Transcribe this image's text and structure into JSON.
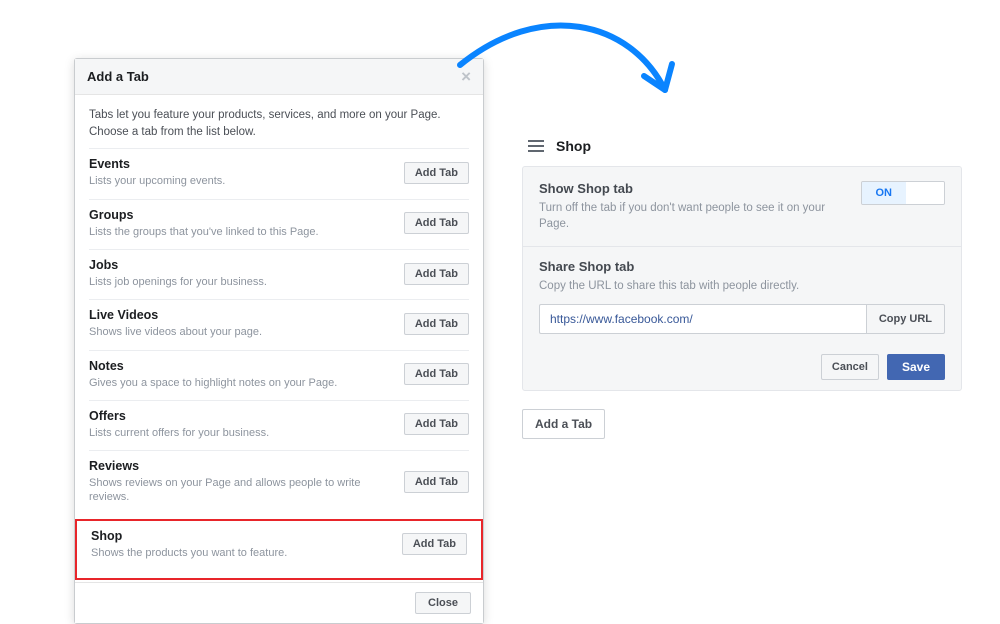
{
  "dialog": {
    "title": "Add a Tab",
    "intro": "Tabs let you feature your products, services, and more on your Page. Choose a tab from the list below.",
    "add_tab_label": "Add Tab",
    "close_label": "Close",
    "tabs": [
      {
        "name": "Events",
        "desc": "Lists your upcoming events."
      },
      {
        "name": "Groups",
        "desc": "Lists the groups that you've linked to this Page."
      },
      {
        "name": "Jobs",
        "desc": "Lists job openings for your business."
      },
      {
        "name": "Live Videos",
        "desc": "Shows live videos about your page."
      },
      {
        "name": "Notes",
        "desc": "Gives you a space to highlight notes on your Page."
      },
      {
        "name": "Offers",
        "desc": "Lists current offers for your business."
      },
      {
        "name": "Reviews",
        "desc": "Shows reviews on your Page and allows people to write reviews."
      },
      {
        "name": "Shop",
        "desc": "Shows the products you want to feature."
      }
    ]
  },
  "panel": {
    "title": "Shop",
    "show": {
      "title": "Show Shop tab",
      "desc": "Turn off the tab if you don't want people to see it on your Page.",
      "state": "ON"
    },
    "share": {
      "title": "Share Shop tab",
      "desc": "Copy the URL to share this tab with people directly.",
      "url": "https://www.facebook.com/",
      "copy_label": "Copy URL"
    },
    "cancel_label": "Cancel",
    "save_label": "Save",
    "add_a_tab_label": "Add a Tab"
  }
}
